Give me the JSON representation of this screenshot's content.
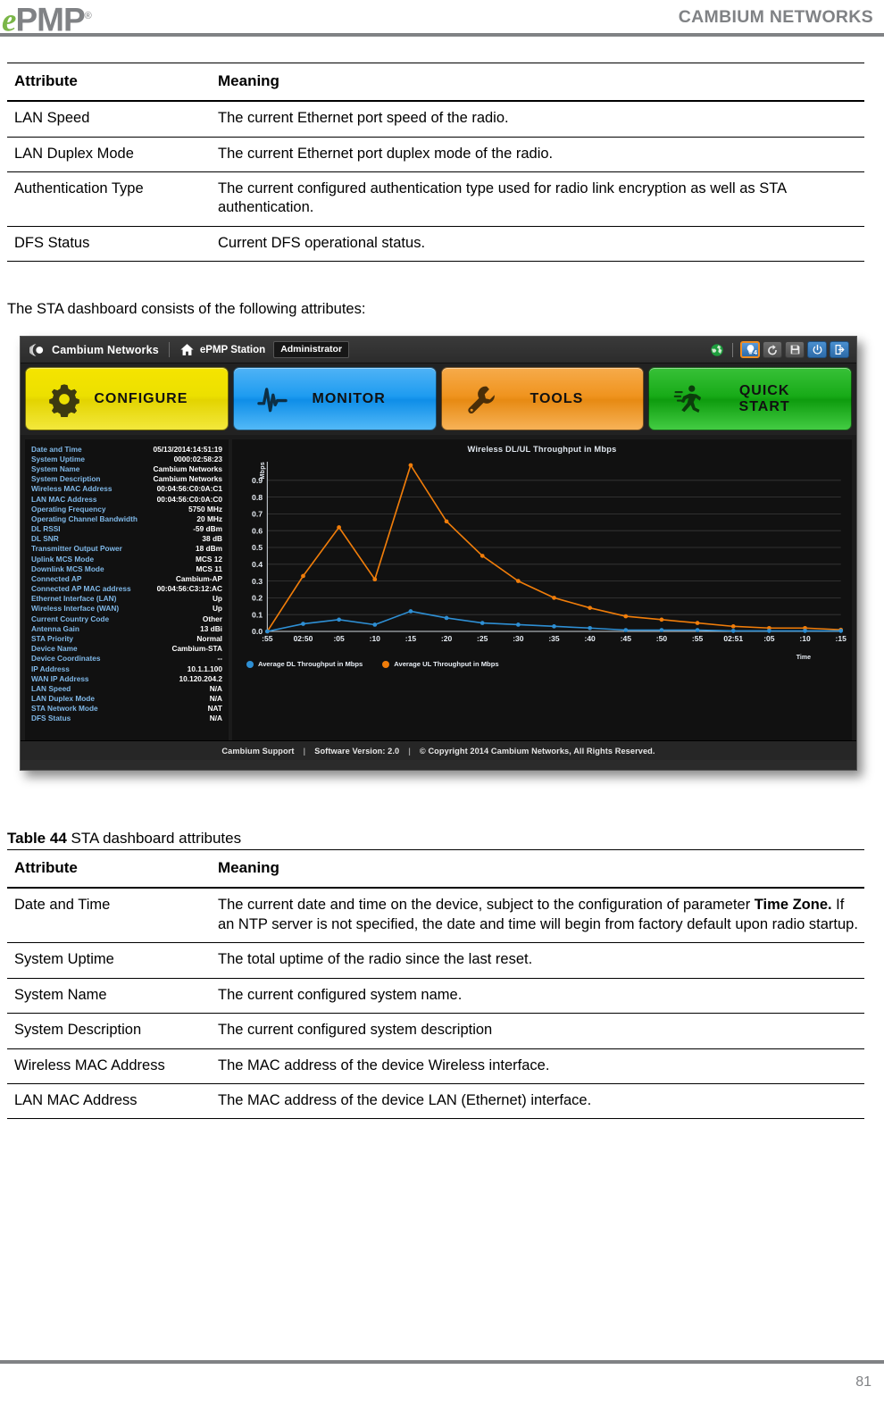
{
  "header": {
    "logo_e": "e",
    "logo_pmp": "PMP",
    "logo_tm": "®",
    "brand": "CAMBIUM NETWORKS"
  },
  "table_top": {
    "columns": [
      "Attribute",
      "Meaning"
    ],
    "rows": [
      {
        "attribute": "LAN Speed",
        "meaning": "The current Ethernet port speed of the radio."
      },
      {
        "attribute": "LAN Duplex Mode",
        "meaning": "The current Ethernet port duplex mode of the radio."
      },
      {
        "attribute": "Authentication Type",
        "meaning": "The current configured authentication type used for radio link encryption as well as STA authentication."
      },
      {
        "attribute": "DFS Status",
        "meaning": "Current DFS operational status."
      }
    ]
  },
  "intro_text": "The STA dashboard consists of the following attributes:",
  "screenshot": {
    "topbar": {
      "company": "Cambium Networks",
      "device": "ePMP Station",
      "role": "Administrator",
      "icons": [
        "globe-icon",
        "lightbulb-icon",
        "undo-icon",
        "save-icon",
        "power-icon",
        "logout-icon"
      ],
      "notification_count": "4"
    },
    "nav": [
      {
        "label": "CONFIGURE",
        "icon": "gear-icon",
        "color": "#ece000"
      },
      {
        "label": "MONITOR",
        "icon": "pulse-icon",
        "color": "#1f9cf0"
      },
      {
        "label": "TOOLS",
        "icon": "wrench-icon",
        "color": "#f0941f"
      },
      {
        "label": "QUICK START",
        "icon": "runner-icon",
        "color": "#18ab18"
      }
    ],
    "status": [
      {
        "key": "Date and Time",
        "value": "05/13/2014:14:51:19"
      },
      {
        "key": "System Uptime",
        "value": "0000:02:58:23"
      },
      {
        "key": "System Name",
        "value": "Cambium Networks"
      },
      {
        "key": "System Description",
        "value": "Cambium Networks"
      },
      {
        "key": "Wireless MAC Address",
        "value": "00:04:56:C0:0A:C1"
      },
      {
        "key": "LAN MAC Address",
        "value": "00:04:56:C0:0A:C0"
      },
      {
        "key": "Operating Frequency",
        "value": "5750 MHz"
      },
      {
        "key": "Operating Channel Bandwidth",
        "value": "20 MHz"
      },
      {
        "key": "DL RSSI",
        "value": "-59 dBm"
      },
      {
        "key": "DL SNR",
        "value": "38 dB"
      },
      {
        "key": "Transmitter Output Power",
        "value": "18 dBm"
      },
      {
        "key": "Uplink MCS Mode",
        "value": "MCS 12"
      },
      {
        "key": "Downlink MCS Mode",
        "value": "MCS 11"
      },
      {
        "key": "Connected AP",
        "value": "Cambium-AP"
      },
      {
        "key": "Connected AP MAC address",
        "value": "00:04:56:C3:12:AC"
      },
      {
        "key": "Ethernet Interface (LAN)",
        "value": "Up"
      },
      {
        "key": "Wireless Interface (WAN)",
        "value": "Up"
      },
      {
        "key": "Current Country Code",
        "value": "Other"
      },
      {
        "key": "Antenna Gain",
        "value": "13 dBi"
      },
      {
        "key": "STA Priority",
        "value": "Normal"
      },
      {
        "key": "Device Name",
        "value": "Cambium-STA"
      },
      {
        "key": "Device Coordinates",
        "value": "--"
      },
      {
        "key": "IP Address",
        "value": "10.1.1.100"
      },
      {
        "key": "WAN IP Address",
        "value": "10.120.204.2"
      },
      {
        "key": "LAN Speed",
        "value": "N/A"
      },
      {
        "key": "LAN Duplex Mode",
        "value": "N/A"
      },
      {
        "key": "STA Network Mode",
        "value": "NAT"
      },
      {
        "key": "DFS Status",
        "value": "N/A"
      }
    ],
    "footer": {
      "support": "Cambium Support",
      "version": "Software Version:  2.0",
      "copyright": "© Copyright 2014 Cambium Networks, All Rights Reserved."
    }
  },
  "chart_data": {
    "type": "line",
    "title": "Wireless DL/UL Throughput in Mbps",
    "xlabel": "Time",
    "ylabel": "Mbps",
    "ylim": [
      0.0,
      1.0
    ],
    "ytick_labels": [
      "0.0",
      "0.1",
      "0.2",
      "0.3",
      "0.4",
      "0.5",
      "0.6",
      "0.7",
      "0.8",
      "0.9"
    ],
    "grid": true,
    "legend_position": "bottom-left",
    "x": [
      ":55",
      "02:50",
      ":05",
      ":10",
      ":15",
      ":20",
      ":25",
      ":30",
      ":35",
      ":40",
      ":45",
      ":50",
      ":55",
      "02:51",
      ":05",
      ":10",
      ":15"
    ],
    "x_tick_labels": [
      ":55",
      "02:50",
      ":05",
      ":10",
      ":15",
      ":20",
      ":25",
      ":30",
      ":35",
      ":40",
      ":45",
      ":50",
      ":55",
      "02:51",
      ":05",
      ":10",
      ":15"
    ],
    "series": [
      {
        "name": "Average DL Throughput in Mbps",
        "color": "#2e8fd4",
        "values": [
          0.0,
          0.045,
          0.07,
          0.04,
          0.12,
          0.08,
          0.05,
          0.04,
          0.03,
          0.02,
          0.008,
          0.008,
          0.008,
          0.003,
          0.003,
          0.003,
          0.003
        ]
      },
      {
        "name": "Average UL Throughput in Mbps",
        "color": "#f07d0a",
        "values": [
          0.0,
          0.33,
          0.62,
          0.31,
          0.99,
          0.655,
          0.45,
          0.3,
          0.2,
          0.14,
          0.09,
          0.07,
          0.05,
          0.03,
          0.02,
          0.02,
          0.01
        ]
      }
    ]
  },
  "table_caption": {
    "number": "Table 44",
    "text": "STA dashboard  attributes"
  },
  "table_bottom": {
    "columns": [
      "Attribute",
      "Meaning"
    ],
    "rows": [
      {
        "attribute": "Date and Time",
        "meaning_pre": "The current date and time on the device, subject to the configuration of parameter ",
        "meaning_bold": "Time Zone.",
        "meaning_post": "  If an NTP server is not specified, the date and time will begin from factory default upon radio startup."
      },
      {
        "attribute": "System Uptime",
        "meaning": "The total uptime of the radio since the last reset."
      },
      {
        "attribute": "System Name",
        "meaning": "The current configured system name."
      },
      {
        "attribute": "System Description",
        "meaning": "The current configured system description"
      },
      {
        "attribute": "Wireless MAC Address",
        "meaning": "The MAC address of the device Wireless interface."
      },
      {
        "attribute": "LAN MAC Address",
        "meaning": "The MAC address of the device LAN (Ethernet) interface."
      }
    ]
  },
  "page_number": "81"
}
